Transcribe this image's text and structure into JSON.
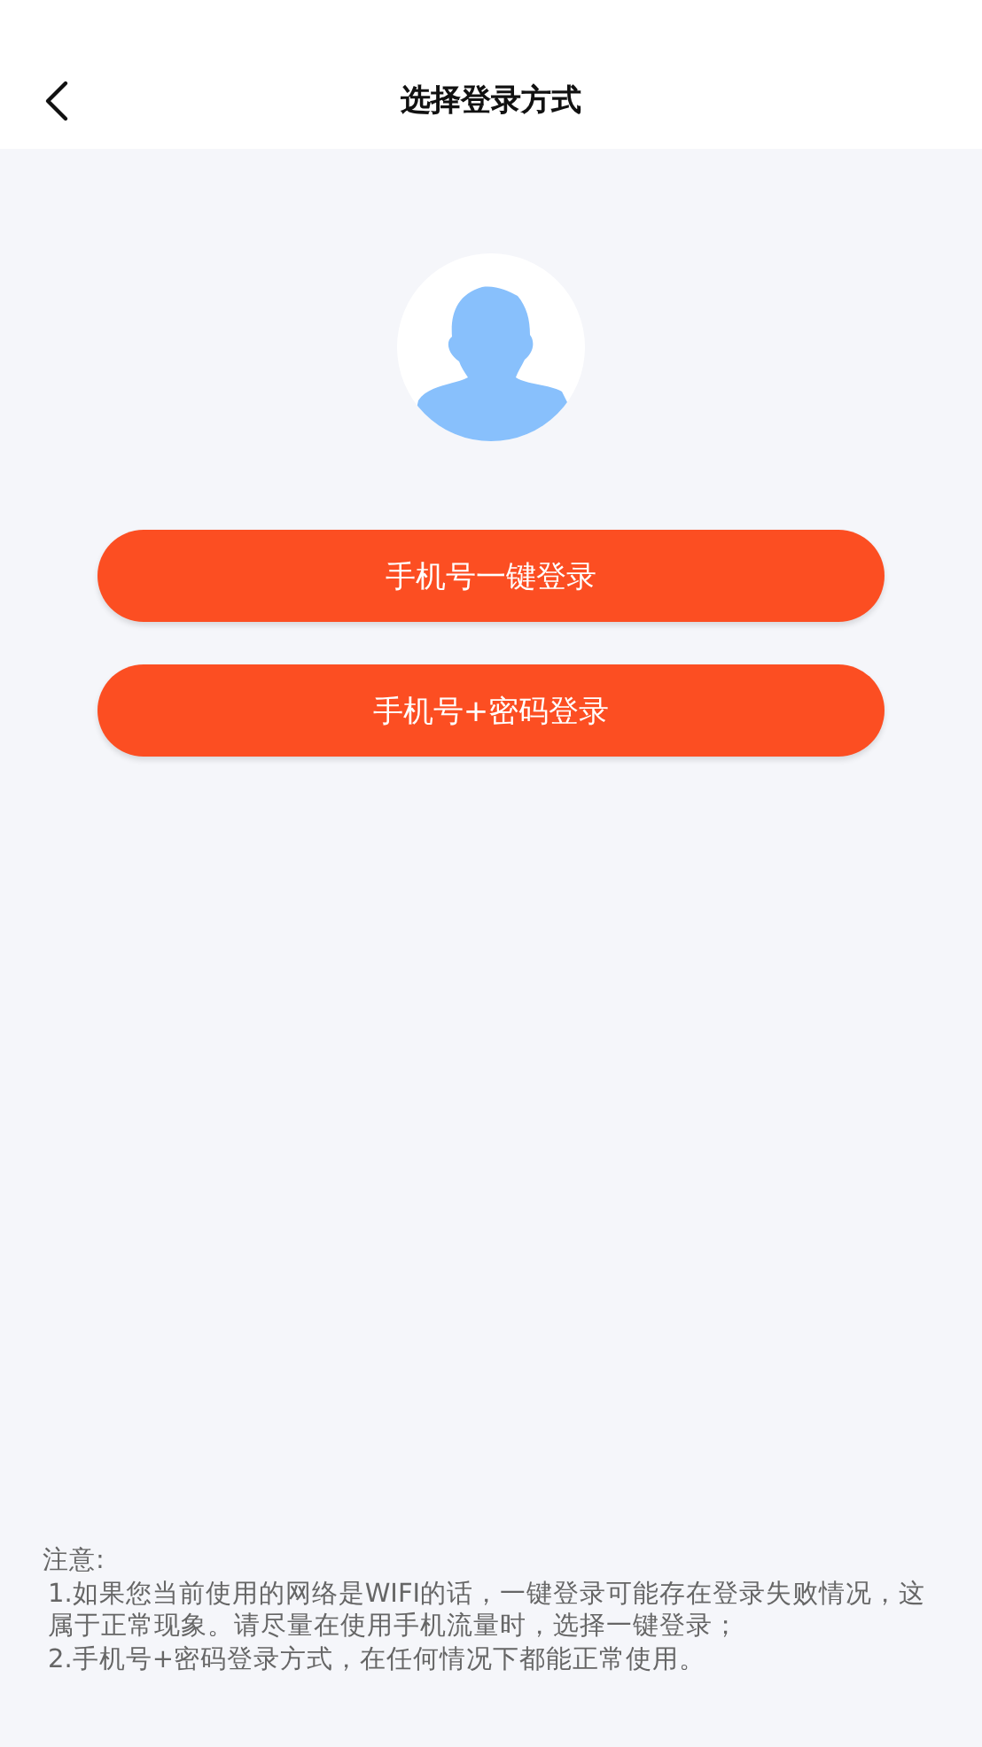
{
  "header": {
    "title": "选择登录方式"
  },
  "buttons": [
    {
      "label": "手机号一键登录"
    },
    {
      "label": "手机号+密码登录"
    }
  ],
  "notice": {
    "title": "注意:",
    "items": [
      "1.如果您当前使用的网络是WIFI的话，一键登录可能存在登录失败情况，这属于正常现象。请尽量在使用手机流量时，选择一键登录；",
      "2.手机号+密码登录方式，在任何情况下都能正常使用。"
    ]
  }
}
